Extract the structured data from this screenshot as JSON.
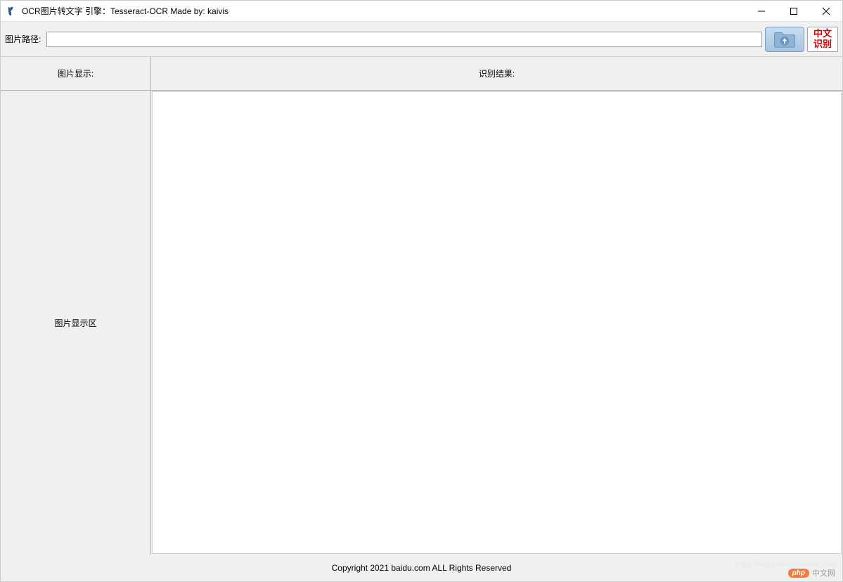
{
  "titlebar": {
    "title": "OCR图片转文字  引擎：Tesseract-OCR  Made by: kaivis"
  },
  "toolbar": {
    "path_label": "图片路径:",
    "path_value": "",
    "recognize_line1": "中文",
    "recognize_line2": "识别"
  },
  "panels": {
    "left_header": "图片显示:",
    "left_placeholder": "图片显示区",
    "right_header": "识别结果:"
  },
  "footer": {
    "copyright": "Copyright 2021 baidu.com ALL Rights Reserved",
    "badge": "php",
    "cn": "中文网",
    "url_watermark": "https://blog.csdn.net/kaivis_new"
  }
}
